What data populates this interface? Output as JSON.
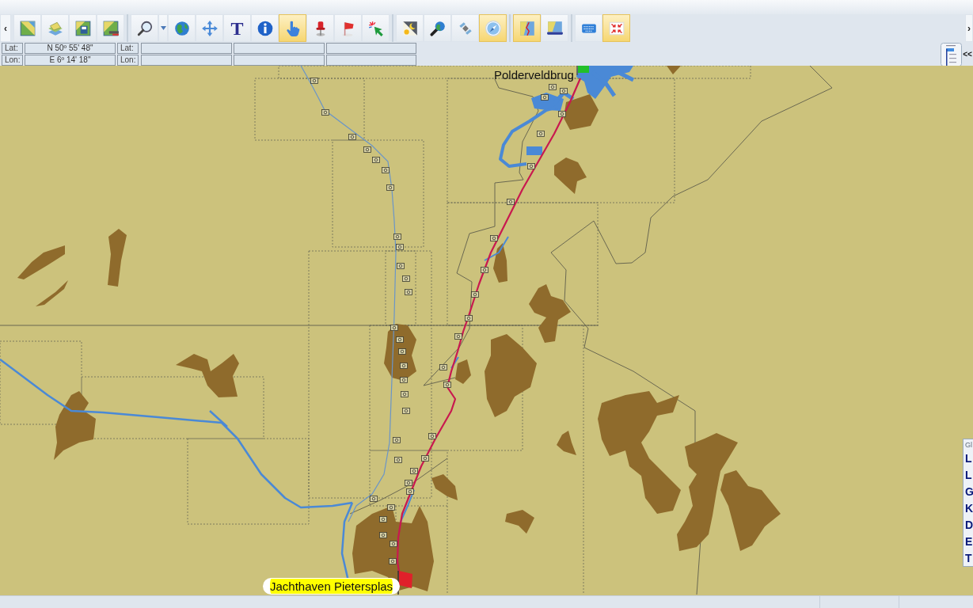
{
  "toolbar": {
    "scroll_left": "‹",
    "groups": [
      [
        {
          "selected": false
        },
        {
          "selected": false
        },
        {
          "selected": false
        },
        {
          "selected": false
        }
      ],
      [
        {
          "selected": false
        },
        {
          "selected": false
        },
        {
          "selected": false
        },
        {
          "selected": false,
          "label": "T"
        },
        {
          "selected": false
        },
        {
          "selected": true
        },
        {
          "selected": false
        },
        {
          "selected": false
        },
        {
          "selected": false
        }
      ],
      [
        {
          "selected": false
        },
        {
          "selected": false
        },
        {
          "selected": false
        },
        {
          "selected": true
        }
      ],
      [
        {
          "selected": true
        },
        {
          "selected": false
        }
      ],
      [
        {
          "selected": false
        },
        {
          "selected": true
        }
      ]
    ],
    "scroll_right": "›"
  },
  "coordinates": {
    "cursor": {
      "lat_label": "Lat:",
      "lat": "N 50º 55' 48\"",
      "lon_label": "Lon:",
      "lon": "E 6º 14' 18\""
    },
    "second": {
      "lat_label": "Lat:",
      "lon_label": "Lon:"
    }
  },
  "layer_panel": {
    "collapse": "<<"
  },
  "map": {
    "start_label": "Polderveldbrug",
    "end_label": "Jachthaven Pietersplas"
  },
  "side_panel": {
    "title": "Gl",
    "items": [
      "L",
      "L",
      "G",
      "K",
      "D",
      "E",
      "T"
    ]
  }
}
